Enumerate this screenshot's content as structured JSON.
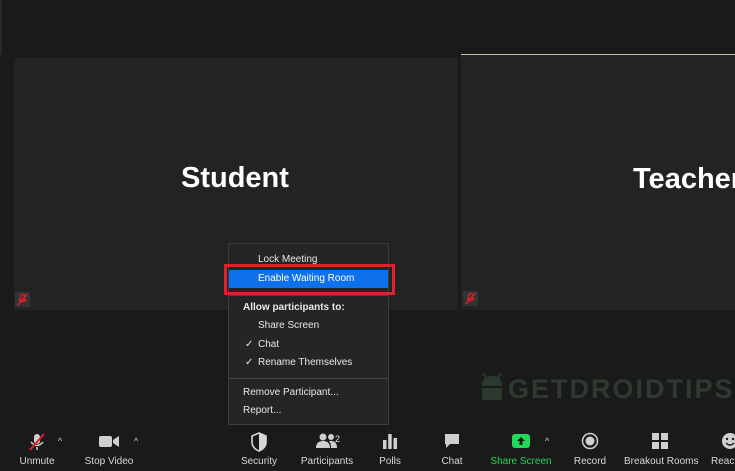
{
  "tiles": [
    {
      "name": "Student"
    },
    {
      "name": "Teacher"
    }
  ],
  "security_menu": {
    "items": [
      {
        "label": "Lock Meeting"
      },
      {
        "label": "Enable Waiting Room",
        "highlighted": true
      },
      {
        "label": "Allow participants to:"
      },
      {
        "label": "Share Screen",
        "checked": false
      },
      {
        "label": "Chat",
        "checked": true
      },
      {
        "label": "Rename Themselves",
        "checked": true
      },
      {
        "label": "Remove Participant..."
      },
      {
        "label": "Report..."
      }
    ],
    "check_glyph": "✓"
  },
  "toolbar": {
    "unmute": "Unmute",
    "stop_video": "Stop Video",
    "security": "Security",
    "participants": "Participants",
    "participants_count": "2",
    "polls": "Polls",
    "chat": "Chat",
    "share_screen": "Share Screen",
    "record": "Record",
    "breakout_rooms": "Breakout Rooms",
    "reactions": "Reacti"
  },
  "watermark": "GETDROIDTIPS",
  "colors": {
    "highlight": "#0e71eb",
    "annotation_red": "#e0202a",
    "share_green": "#23d959"
  }
}
